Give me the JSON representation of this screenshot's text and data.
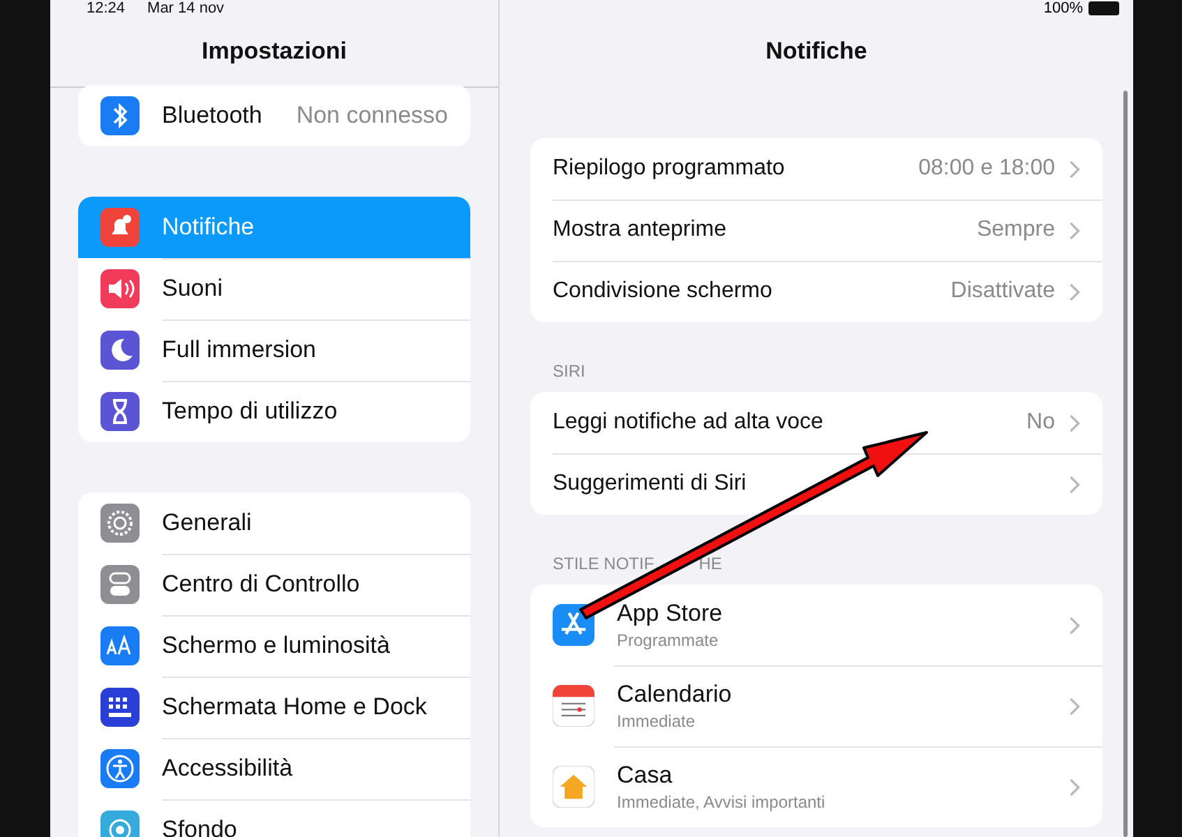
{
  "status_bar": {
    "time": "12:24",
    "date": "Mar 14 nov",
    "battery": "100%"
  },
  "sidebar": {
    "title": "Impostazioni",
    "groups": [
      {
        "items": [
          {
            "label": "Bluetooth",
            "value": "Non connesso",
            "selected": false
          }
        ]
      },
      {
        "items": [
          {
            "label": "Notifiche",
            "selected": true
          },
          {
            "label": "Suoni",
            "selected": false
          },
          {
            "label": "Full immersion",
            "selected": false
          },
          {
            "label": "Tempo di utilizzo",
            "selected": false
          }
        ]
      },
      {
        "items": [
          {
            "label": "Generali",
            "selected": false
          },
          {
            "label": "Centro di Controllo",
            "selected": false
          },
          {
            "label": "Schermo e luminosità",
            "selected": false
          },
          {
            "label": "Schermata Home e Dock",
            "selected": false
          },
          {
            "label": "Accessibilità",
            "selected": false
          },
          {
            "label": "Sfondo",
            "selected": false
          }
        ]
      }
    ]
  },
  "detail": {
    "title": "Notifiche",
    "groups": [
      {
        "rows": [
          {
            "label": "Riepilogo programmato",
            "value": "08:00 e 18:00"
          },
          {
            "label": "Mostra anteprime",
            "value": "Sempre"
          },
          {
            "label": "Condivisione schermo",
            "value": "Disattivate"
          }
        ]
      },
      {
        "header": "SIRI",
        "rows": [
          {
            "label": "Leggi notifiche ad alta voce",
            "value": "No"
          },
          {
            "label": "Suggerimenti di Siri"
          }
        ]
      }
    ],
    "apps_header": [
      "STILE NOTIF",
      "HE"
    ],
    "apps": [
      {
        "name": "App Store",
        "style": "Programmate"
      },
      {
        "name": "Calendario",
        "style": "Immediate"
      },
      {
        "name": "Casa",
        "style": "Immediate, Avvisi importanti"
      }
    ]
  }
}
